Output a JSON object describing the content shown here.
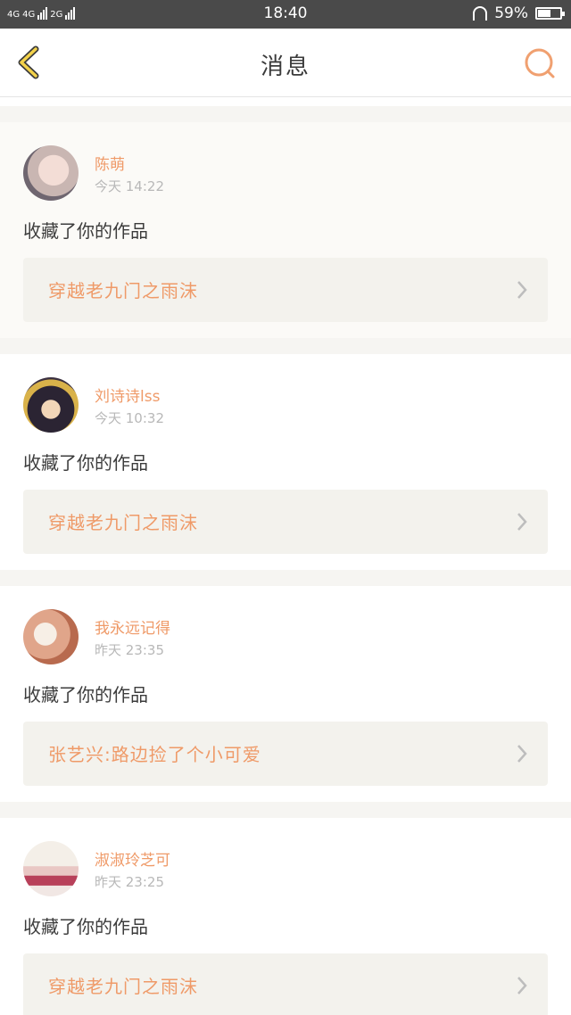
{
  "status_bar": {
    "network_left": "4G",
    "network_mid": "4G",
    "network_right": "2G",
    "time": "18:40",
    "battery": "59%",
    "battery_level": 0.59
  },
  "nav": {
    "title": "消息",
    "accent_color": "#f0a070",
    "back_icon": "chevron-left-icon",
    "search_icon": "search-icon"
  },
  "messages": [
    {
      "user": "陈萌",
      "time": "今天 14:22",
      "action": "收藏了你的作品",
      "work": "穿越老九门之雨沫"
    },
    {
      "user": "刘诗诗lss",
      "time": "今天 10:32",
      "action": "收藏了你的作品",
      "work": "穿越老九门之雨沫"
    },
    {
      "user": "我永远记得",
      "time": "昨天 23:35",
      "action": "收藏了你的作品",
      "work": "张艺兴:路边捡了个小可爱"
    },
    {
      "user": "淑淑玲芝可",
      "time": "昨天 23:25",
      "action": "收藏了你的作品",
      "work": "穿越老九门之雨沫"
    }
  ]
}
